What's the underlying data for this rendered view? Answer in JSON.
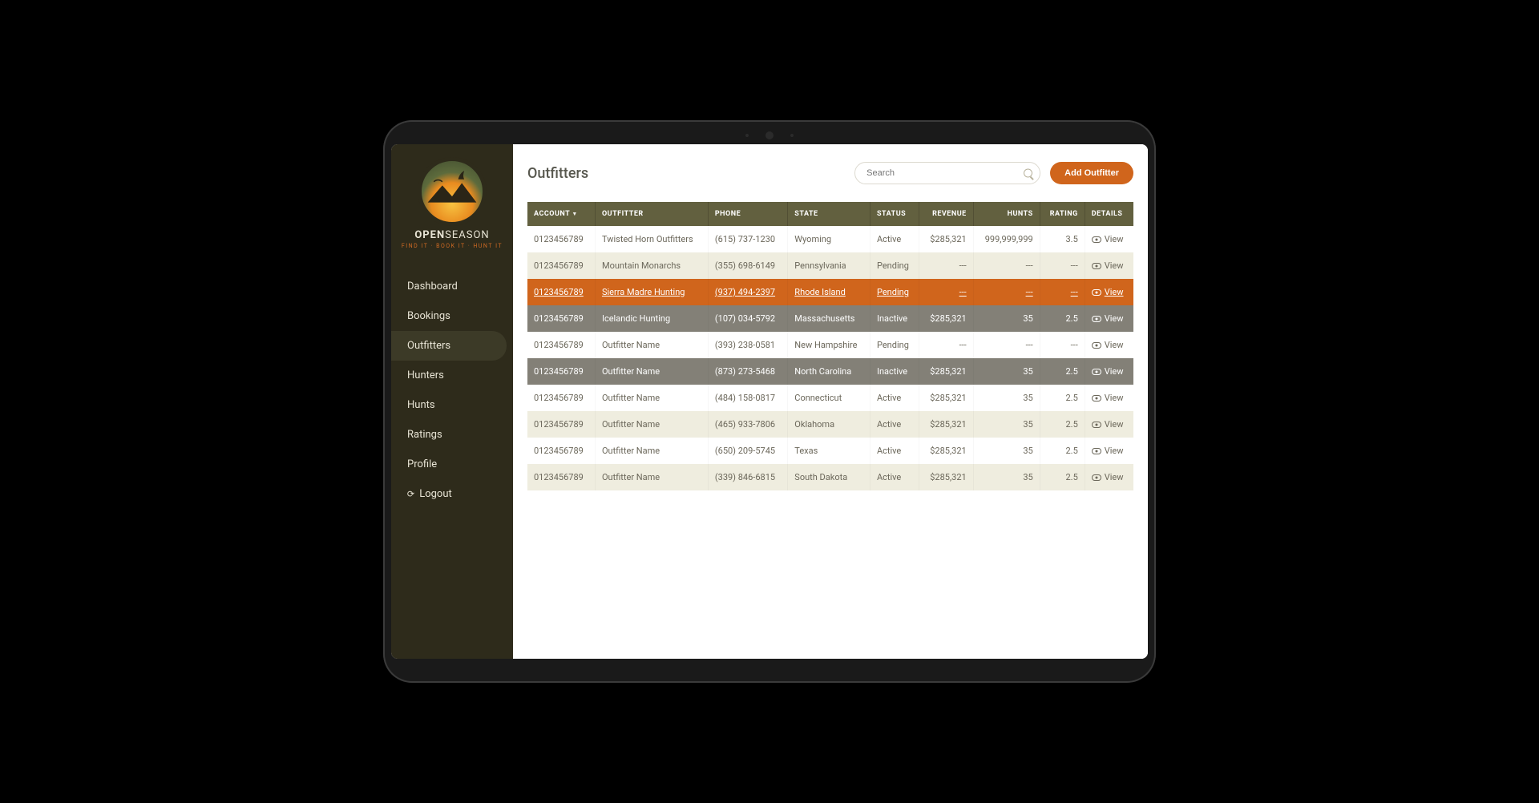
{
  "brand": {
    "name_a": "OPEN",
    "name_b": "SEASON",
    "tagline": "FIND IT · BOOK IT · HUNT IT"
  },
  "sidebar": {
    "items": [
      {
        "label": "Dashboard",
        "active": false
      },
      {
        "label": "Bookings",
        "active": false
      },
      {
        "label": "Outfitters",
        "active": true
      },
      {
        "label": "Hunters",
        "active": false
      },
      {
        "label": "Hunts",
        "active": false
      },
      {
        "label": "Ratings",
        "active": false
      },
      {
        "label": "Profile",
        "active": false
      }
    ],
    "logout_label": "Logout"
  },
  "header": {
    "title": "Outfitters",
    "search_placeholder": "Search",
    "add_button_label": "Add Outfitter"
  },
  "table": {
    "columns": {
      "account": "ACCOUNT",
      "outfitter": "OUTFITTER",
      "phone": "PHONE",
      "state": "STATE",
      "status": "STATUS",
      "revenue": "REVENUE",
      "hunts": "HUNTS",
      "rating": "RATING",
      "details": "DETAILS"
    },
    "view_label": "View",
    "rows": [
      {
        "account": "0123456789",
        "outfitter": "Twisted Horn Outfitters",
        "phone": "(615) 737-1230",
        "state": "Wyoming",
        "status": "Active",
        "revenue": "$285,321",
        "hunts": "999,999,999",
        "rating": "3.5",
        "row_state": ""
      },
      {
        "account": "0123456789",
        "outfitter": "Mountain Monarchs",
        "phone": "(355) 698-6149",
        "state": "Pennsylvania",
        "status": "Pending",
        "revenue": "---",
        "hunts": "---",
        "rating": "---",
        "row_state": ""
      },
      {
        "account": "0123456789",
        "outfitter": "Sierra Madre Hunting",
        "phone": "(937) 494-2397",
        "state": "Rhode Island",
        "status": "Pending",
        "revenue": "---",
        "hunts": "---",
        "rating": "---",
        "row_state": "selected"
      },
      {
        "account": "0123456789",
        "outfitter": "Icelandic Hunting",
        "phone": "(107) 034-5792",
        "state": "Massachusetts",
        "status": "Inactive",
        "revenue": "$285,321",
        "hunts": "35",
        "rating": "2.5",
        "row_state": "inactive"
      },
      {
        "account": "0123456789",
        "outfitter": "Outfitter Name",
        "phone": "(393) 238-0581",
        "state": "New Hampshire",
        "status": "Pending",
        "revenue": "---",
        "hunts": "---",
        "rating": "---",
        "row_state": ""
      },
      {
        "account": "0123456789",
        "outfitter": "Outfitter Name",
        "phone": "(873) 273-5468",
        "state": "North Carolina",
        "status": "Inactive",
        "revenue": "$285,321",
        "hunts": "35",
        "rating": "2.5",
        "row_state": "inactive"
      },
      {
        "account": "0123456789",
        "outfitter": "Outfitter Name",
        "phone": "(484) 158-0817",
        "state": "Connecticut",
        "status": "Active",
        "revenue": "$285,321",
        "hunts": "35",
        "rating": "2.5",
        "row_state": ""
      },
      {
        "account": "0123456789",
        "outfitter": "Outfitter Name",
        "phone": "(465) 933-7806",
        "state": "Oklahoma",
        "status": "Active",
        "revenue": "$285,321",
        "hunts": "35",
        "rating": "2.5",
        "row_state": ""
      },
      {
        "account": "0123456789",
        "outfitter": "Outfitter Name",
        "phone": "(650) 209-5745",
        "state": "Texas",
        "status": "Active",
        "revenue": "$285,321",
        "hunts": "35",
        "rating": "2.5",
        "row_state": ""
      },
      {
        "account": "0123456789",
        "outfitter": "Outfitter Name",
        "phone": "(339) 846-6815",
        "state": "South Dakota",
        "status": "Active",
        "revenue": "$285,321",
        "hunts": "35",
        "rating": "2.5",
        "row_state": ""
      }
    ]
  }
}
